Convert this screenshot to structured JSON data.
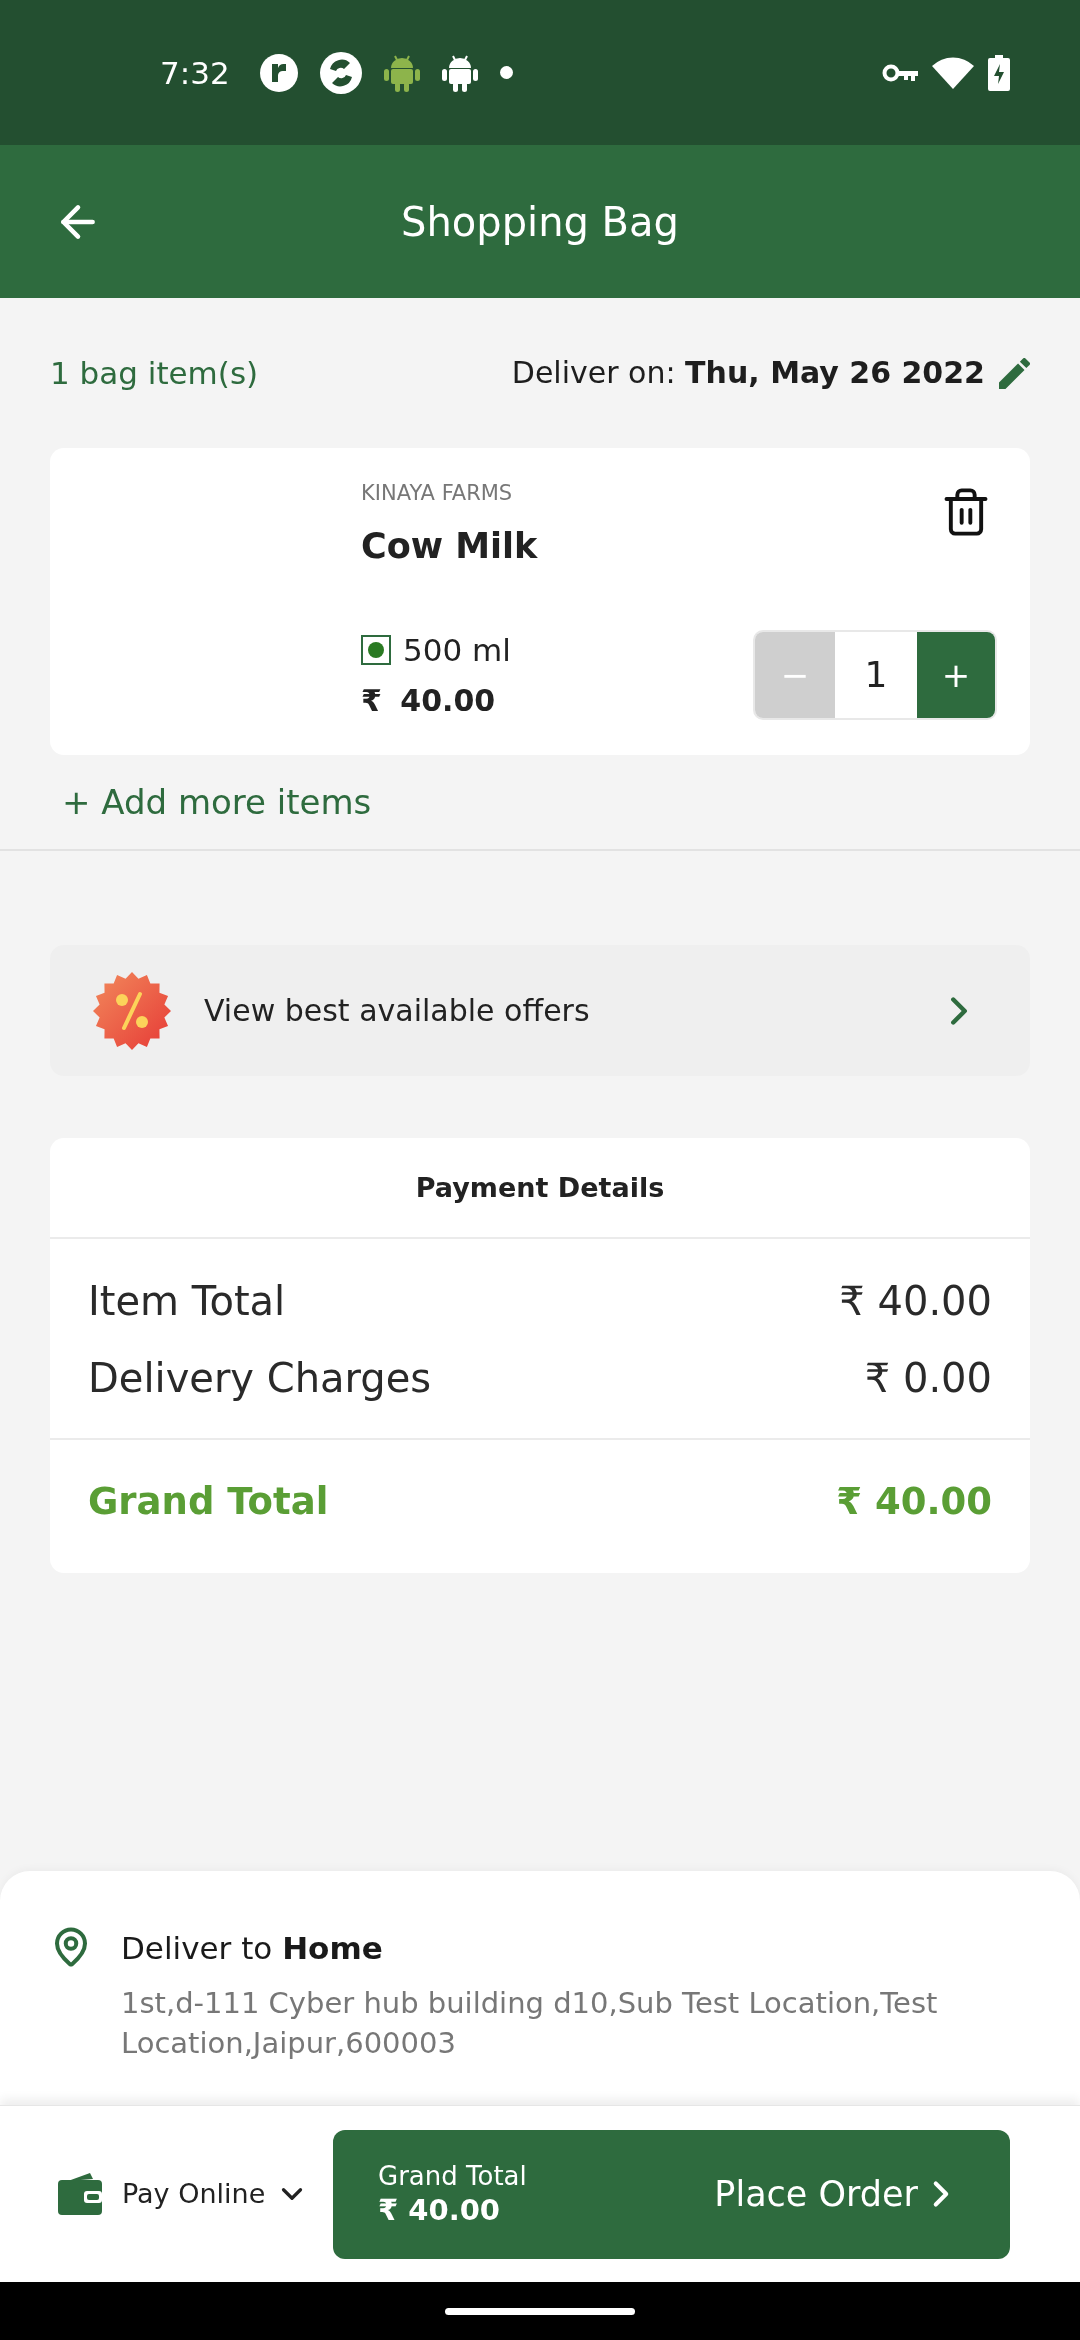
{
  "status_bar": {
    "time": "7:32"
  },
  "header": {
    "title": "Shopping Bag"
  },
  "summary": {
    "item_count": "1 bag item(s)",
    "delivery_date": "Deliver on: **Thu, May 26 2022**"
  },
  "bag_items": [
    {
      "brand": "KINAYA FARMS",
      "name": "Cow Milk",
      "pack_size": "500 ml",
      "price": "₹ 40.00",
      "decrement": "−",
      "quantity": "1",
      "increment": "+",
      "decrement_disabled": true
    }
  ],
  "add_more": "+ Add more items",
  "offers": {
    "label": "View best available offers"
  },
  "payment_details": {
    "title": "Payment Details",
    "rows": [
      {
        "label": "Item Total",
        "value": "₹ 40.00"
      },
      {
        "label": "Delivery Charges",
        "value": "₹ 0.00"
      }
    ],
    "grand_total": {
      "label": "Grand Total",
      "value": "₹ 40.00"
    }
  },
  "delivery_address": {
    "heading": "Deliver to **Home**",
    "address": "1st,d-111 Cyber hub building d10,Sub Test Location,Test Location,Jaipur,600003"
  },
  "checkout": {
    "payment_method": "Pay Online",
    "total_label": "Grand Total",
    "total_value": "₹ 40.00",
    "action": "Place Order"
  }
}
